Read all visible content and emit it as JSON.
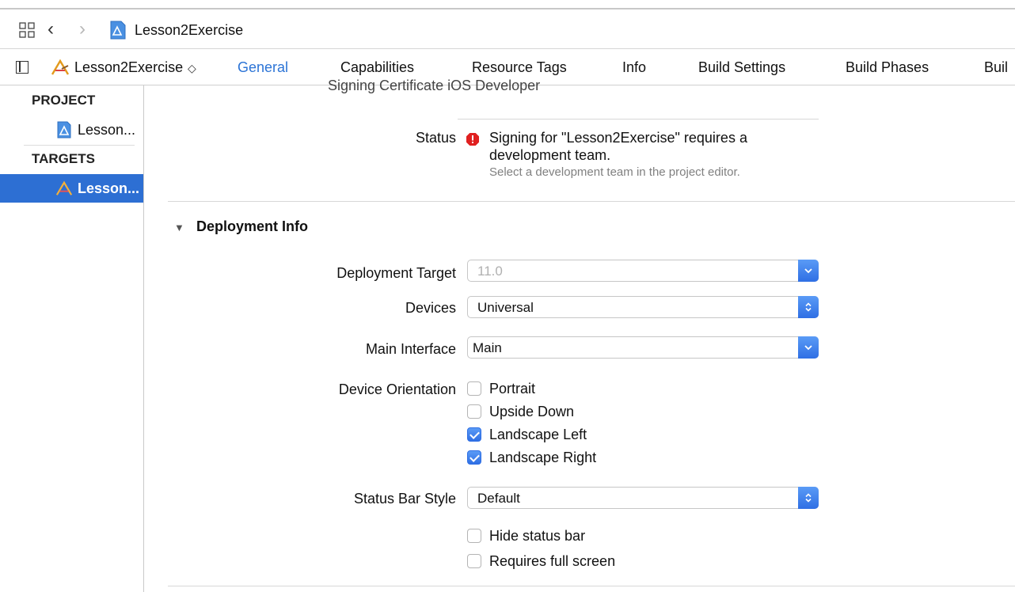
{
  "window": {
    "title": "Lesson2Exercise"
  },
  "tabbar": {
    "target": "Lesson2Exercise",
    "tabs": [
      "General",
      "Capabilities",
      "Resource Tags",
      "Info",
      "Build Settings",
      "Build Phases",
      "Buil"
    ],
    "active": "General"
  },
  "sidebar": {
    "project_header": "PROJECT",
    "project_item": "Lesson...",
    "targets_header": "TARGETS",
    "target_item": "Lesson..."
  },
  "signing": {
    "clipped_row": "Signing Certificate   iOS Developer",
    "status_label": "Status",
    "status_message": "Signing for \"Lesson2Exercise\" requires a development team.",
    "status_hint": "Select a development team in the project editor."
  },
  "deployment": {
    "section_title": "Deployment Info",
    "target_label": "Deployment Target",
    "target_value": "11.0",
    "devices_label": "Devices",
    "devices_value": "Universal",
    "main_interface_label": "Main Interface",
    "main_interface_value": "Main",
    "orientation_label": "Device Orientation",
    "orientations": [
      {
        "label": "Portrait",
        "checked": false
      },
      {
        "label": "Upside Down",
        "checked": false
      },
      {
        "label": "Landscape Left",
        "checked": true
      },
      {
        "label": "Landscape Right",
        "checked": true
      }
    ],
    "status_bar_label": "Status Bar Style",
    "status_bar_value": "Default",
    "hide_status_bar": {
      "label": "Hide status bar",
      "checked": false
    },
    "requires_full_screen": {
      "label": "Requires full screen",
      "checked": false
    }
  },
  "colors": {
    "accent": "#2c74d6",
    "selection": "#2d6fd3",
    "error": "#e02020"
  }
}
